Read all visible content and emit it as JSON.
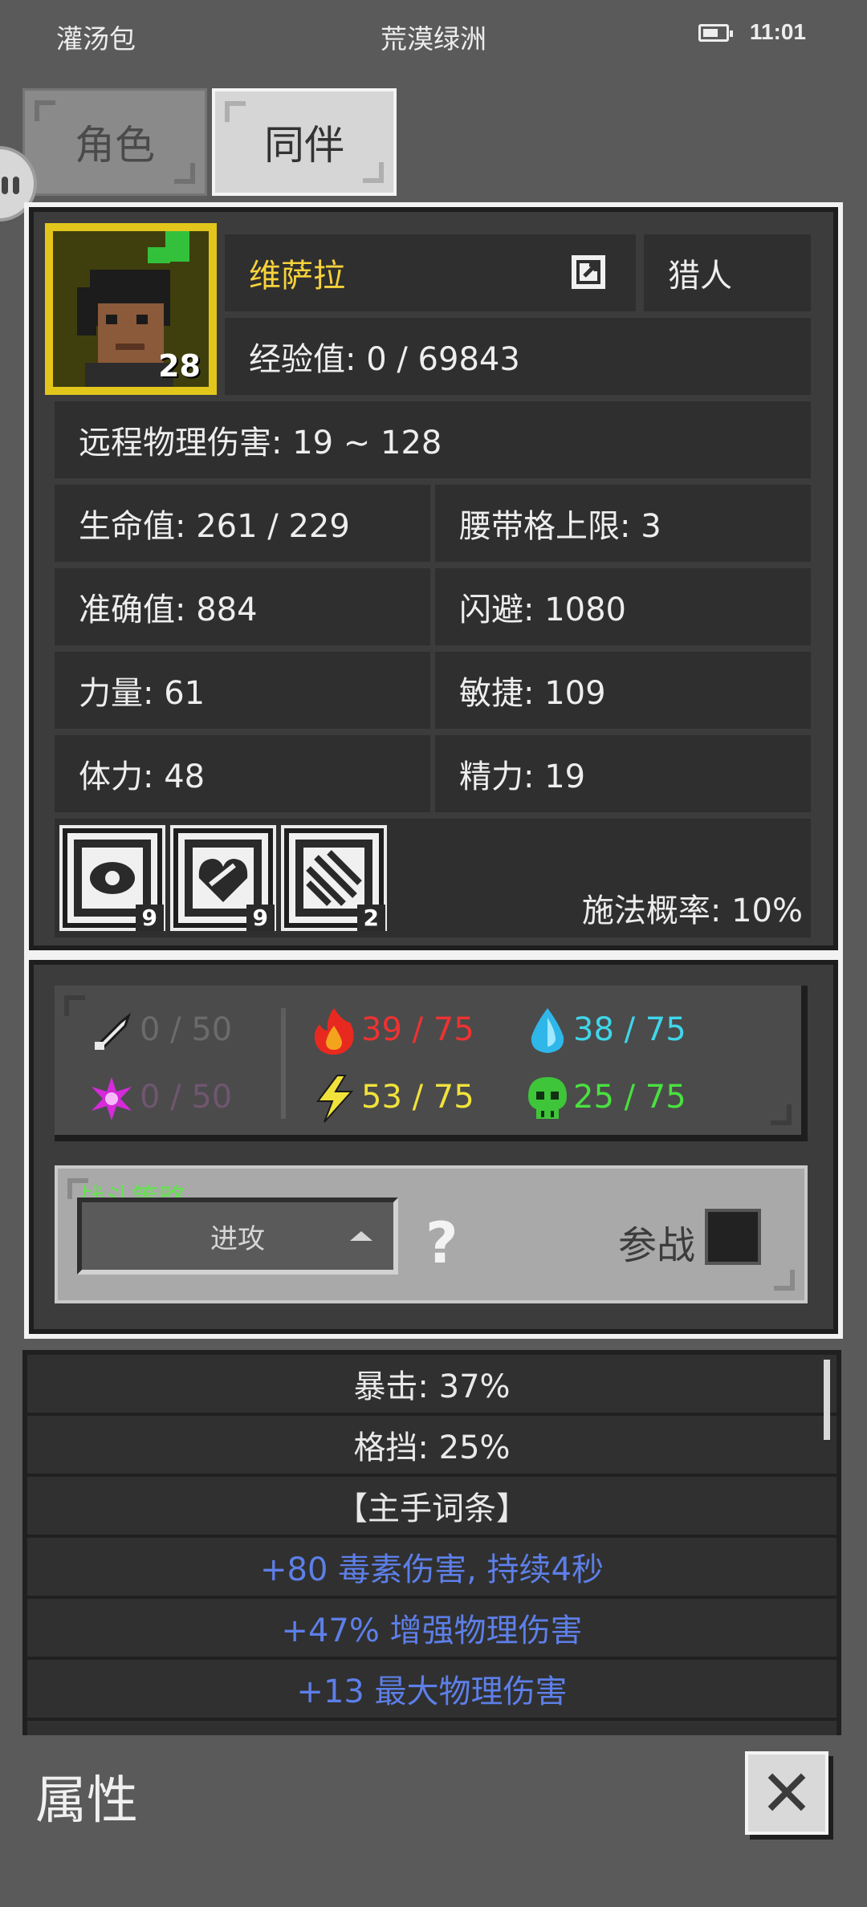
{
  "status_bar": {
    "left": "灌汤包",
    "title": "荒漠绿洲",
    "time": "11:01"
  },
  "tabs": [
    {
      "label": "角色",
      "active": false
    },
    {
      "label": "同伴",
      "active": true
    }
  ],
  "character": {
    "name": "维萨拉",
    "class": "猎人",
    "level": "28",
    "experience": "经验值: 0 / 69843",
    "damage": "远程物理伤害: 19 ~ 128",
    "stats": [
      "生命值: 261 / 229",
      "腰带格上限: 3",
      "准确值: 884",
      "闪避: 1080",
      "力量: 61",
      "敏捷: 109",
      "体力: 48",
      "精力: 19"
    ],
    "skills": [
      {
        "icon": "eye-skill-icon",
        "count": "9"
      },
      {
        "icon": "heart-skill-icon",
        "count": "9"
      },
      {
        "icon": "claw-skill-icon",
        "count": "2"
      }
    ],
    "cast_chance": "施法概率: 10%"
  },
  "resistances": {
    "physical": "0 / 50",
    "magic": "0 / 50",
    "fire": "39 / 75",
    "cold": "38 / 75",
    "lightning": "53 / 75",
    "poison": "25 / 75",
    "colors": {
      "physical": "#6b6b6b",
      "magic": "#6f566f",
      "fire": "#ee3232",
      "cold": "#3fd6ea",
      "lightning": "#f1e23b",
      "poison": "#49e13f"
    }
  },
  "strategy": {
    "label": "战斗策略",
    "value": "进攻",
    "join_label": "参战"
  },
  "attributes": [
    {
      "text": "暴击: 37%",
      "type": "normal"
    },
    {
      "text": "格挡: 25%",
      "type": "normal"
    },
    {
      "text": "【主手词条】",
      "type": "normal"
    },
    {
      "text": "+80 毒素伤害, 持续4秒",
      "type": "blue"
    },
    {
      "text": "+47% 增强物理伤害",
      "type": "blue"
    },
    {
      "text": "+13 最大物理伤害",
      "type": "blue"
    }
  ],
  "footer": {
    "title": "属性"
  },
  "accent_colors": {
    "name": "#f7d23a",
    "affix": "#5d7fe8"
  }
}
